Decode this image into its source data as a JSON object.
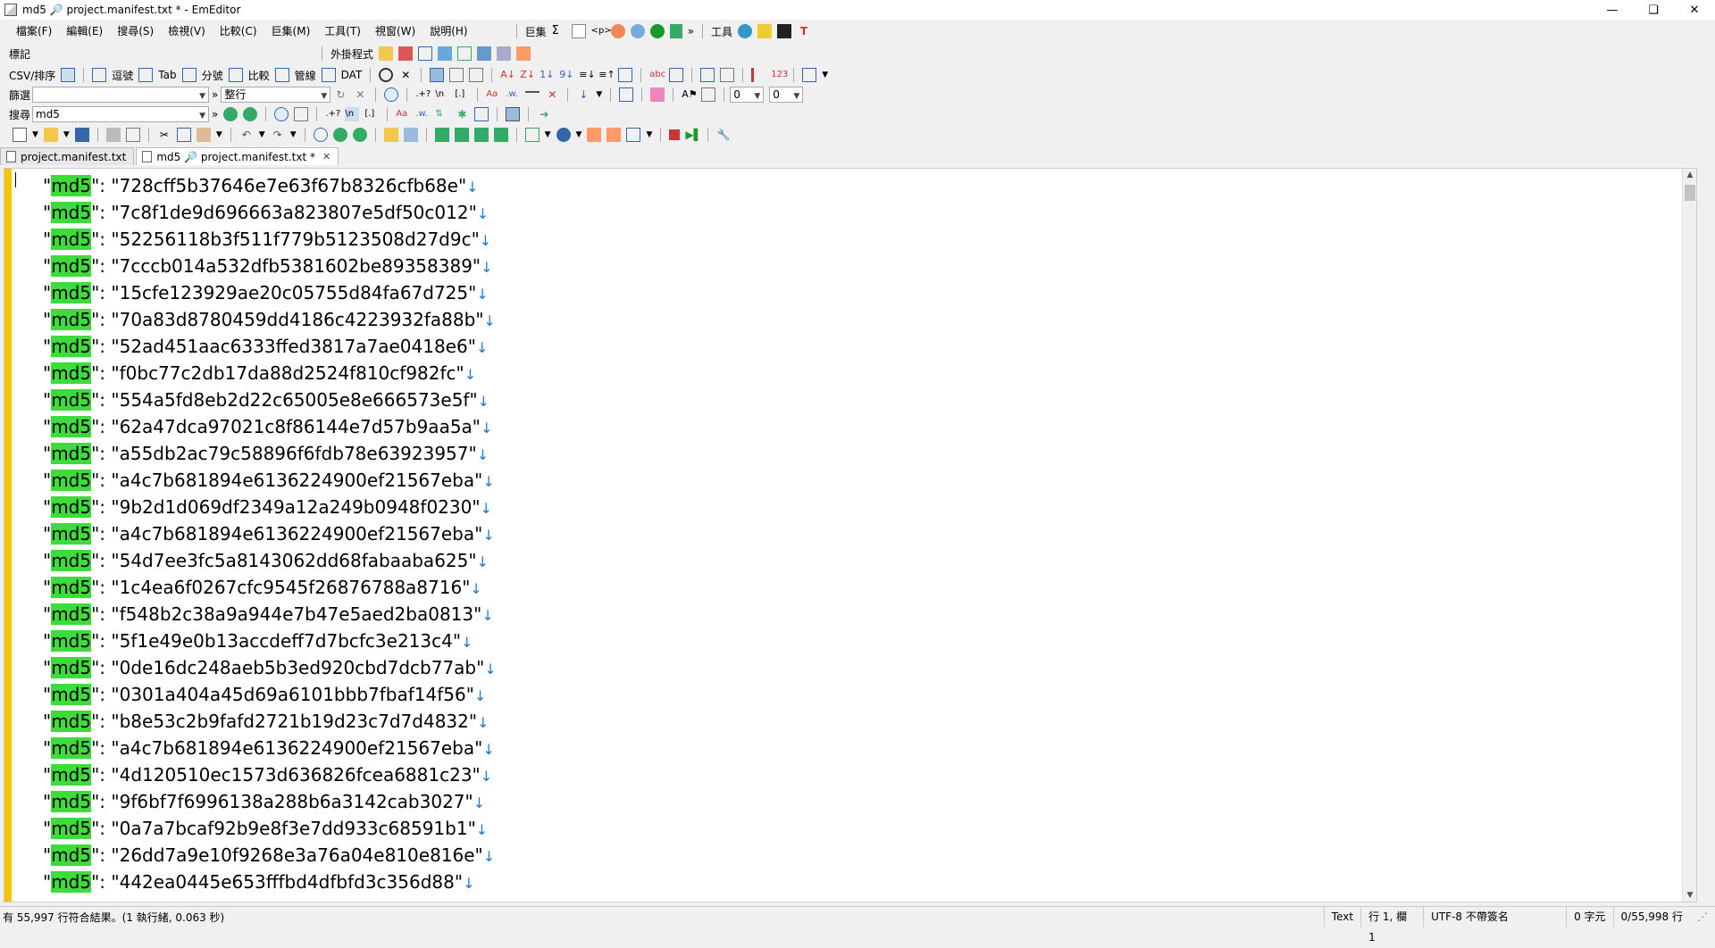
{
  "window": {
    "title": "md5 🔎 project.manifest.txt * - EmEditor",
    "controls": [
      "—",
      "❏",
      "✕"
    ]
  },
  "menu": {
    "items": [
      "檔案(F)",
      "編輯(E)",
      "搜尋(S)",
      "檢視(V)",
      "比較(C)",
      "巨集(M)",
      "工具(T)",
      "視窗(W)",
      "說明(H)"
    ],
    "macro_label": "巨集",
    "tools_label": "工具"
  },
  "toolbar_bookmark": {
    "label": "標記",
    "plugins_label": "外掛程式"
  },
  "toolbar_csv": {
    "label": "CSV/排序",
    "buttons": [
      "逗號",
      "Tab",
      "分號",
      "比較",
      "管線",
      "DAT"
    ]
  },
  "toolbar_filter": {
    "label": "篩選",
    "filter_value": "",
    "mode_value": "整行",
    "num1": "0",
    "num2": "0"
  },
  "toolbar_search": {
    "label": "搜尋",
    "search_value": "md5"
  },
  "tabs": [
    {
      "label": "project.manifest.txt",
      "active": false
    },
    {
      "label": "md5 🔎 project.manifest.txt *",
      "active": true
    }
  ],
  "editor": {
    "keyword": "md5",
    "lines": [
      "728cff5b37646e7e63f67b8326cfb68e",
      "7c8f1de9d696663a823807e5df50c012",
      "52256118b3f511f779b5123508d27d9c",
      "7cccb014a532dfb5381602be89358389",
      "15cfe123929ae20c05755d84fa67d725",
      "70a83d8780459dd4186c4223932fa88b",
      "52ad451aac6333ffed3817a7ae0418e6",
      "f0bc77c2db17da88d2524f810cf982fc",
      "554a5fd8eb2d22c65005e8e666573e5f",
      "62a47dca97021c8f86144e7d57b9aa5a",
      "a55db2ac79c58896f6fdb78e63923957",
      "a4c7b681894e6136224900ef21567eba",
      "9b2d1d069df2349a12a249b0948f0230",
      "a4c7b681894e6136224900ef21567eba",
      "54d7ee3fc5a8143062dd68fabaaba625",
      "1c4ea6f0267cfc9545f26876788a8716",
      "f548b2c38a9a944e7b47e5aed2ba0813",
      "5f1e49e0b13accdeff7d7bcfc3e213c4",
      "0de16dc248aeb5b3ed920cbd7dcb77ab",
      "0301a404a45d69a6101bbb7fbaf14f56",
      "b8e53c2b9fafd2721b19d23c7d7d4832",
      "a4c7b681894e6136224900ef21567eba",
      "4d120510ec1573d636826fcea6881c23",
      "9f6bf7f6996138a288b6a3142cab3027",
      "0a7a7bcaf92b9e8f3e7dd933c68591b1",
      "26dd7a9e10f9268e3a76a04e810e816e",
      "442ea0445e653fffbd4dfbfd3c356d88"
    ]
  },
  "status": {
    "left": "有 55,997 行符合結果。(1 執行緒, 0.063 秒)",
    "mode": "Text",
    "position": "行 1, 欄 1",
    "encoding": "UTF-8 不帶簽名",
    "chars": "0 字元",
    "lines_count": "0/55,998 行"
  },
  "colors": {
    "highlight": "#3ddc3a",
    "gutter": "#f7c400",
    "return_mark": "#1a7ad6"
  }
}
